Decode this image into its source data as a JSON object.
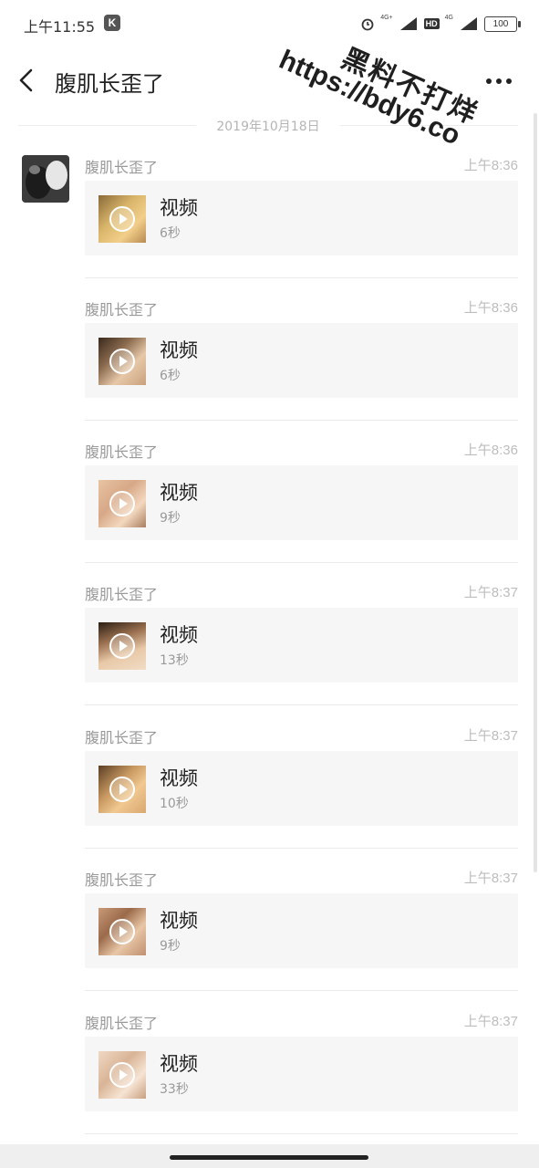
{
  "status_bar": {
    "time": "上午11:55",
    "app_badge": "K",
    "network_tag_1": "4G+",
    "hd_label": "HD",
    "network_tag_2": "4G",
    "battery": "100"
  },
  "header": {
    "title": "腹肌长歪了"
  },
  "chat": {
    "date": "2019年10月18日",
    "messages": [
      {
        "sender": "腹肌长歪了",
        "time": "上午8:36",
        "title": "视频",
        "duration": "6秒"
      },
      {
        "sender": "腹肌长歪了",
        "time": "上午8:36",
        "title": "视频",
        "duration": "6秒"
      },
      {
        "sender": "腹肌长歪了",
        "time": "上午8:36",
        "title": "视频",
        "duration": "9秒"
      },
      {
        "sender": "腹肌长歪了",
        "time": "上午8:37",
        "title": "视频",
        "duration": "13秒"
      },
      {
        "sender": "腹肌长歪了",
        "time": "上午8:37",
        "title": "视频",
        "duration": "10秒"
      },
      {
        "sender": "腹肌长歪了",
        "time": "上午8:37",
        "title": "视频",
        "duration": "9秒"
      },
      {
        "sender": "腹肌长歪了",
        "time": "上午8:37",
        "title": "视频",
        "duration": "33秒"
      }
    ]
  },
  "watermark": {
    "line1": "黑料不打烊",
    "line2": "https://bdy6.co"
  },
  "icons": {
    "back": "back-arrow-icon",
    "more": "more-icon",
    "play": "play-icon"
  }
}
